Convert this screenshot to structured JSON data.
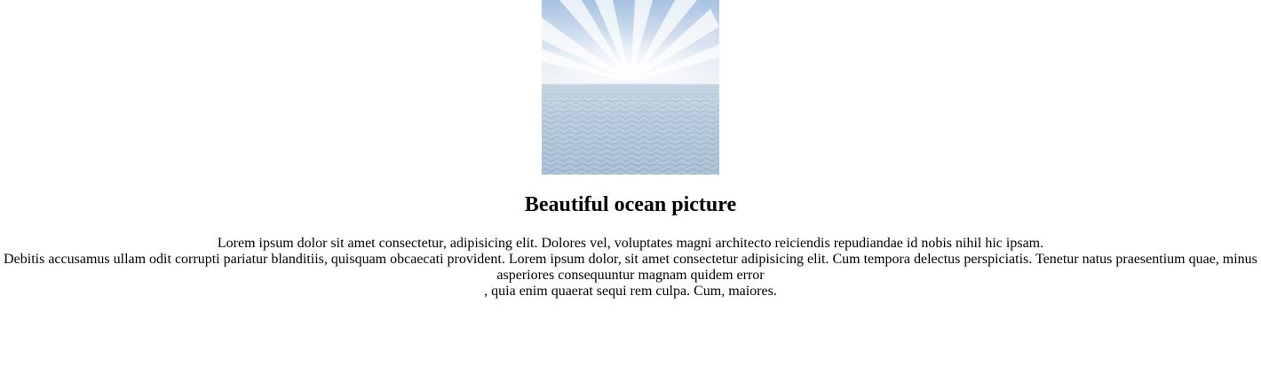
{
  "figure": {
    "image_description_icon": "ocean-photo"
  },
  "heading": {
    "text": "Beautiful ocean picture"
  },
  "paragraph": {
    "line1": "Lorem ipsum dolor sit amet consectetur, adipisicing elit. Dolores vel, voluptates magni architecto reiciendis repudiandae id nobis nihil hic ipsam.",
    "line2": "Debitis accusamus ullam odit corrupti pariatur blanditiis, quisquam obcaecati provident. Lorem ipsum dolor, sit amet consectetur adipisicing elit. Cum tempora delectus perspiciatis. Tenetur natus praesentium quae, minus asperiores consequuntur magnam quidem error",
    "line3": ", quia enim quaerat sequi rem culpa. Cum, maiores."
  },
  "colors": {
    "sky_top": "#aac4e2",
    "sky_mid": "#e9eff6",
    "horizon": "#eef2f5",
    "sea_near": "#a9c1d6",
    "sea_far": "#bfd0df"
  }
}
